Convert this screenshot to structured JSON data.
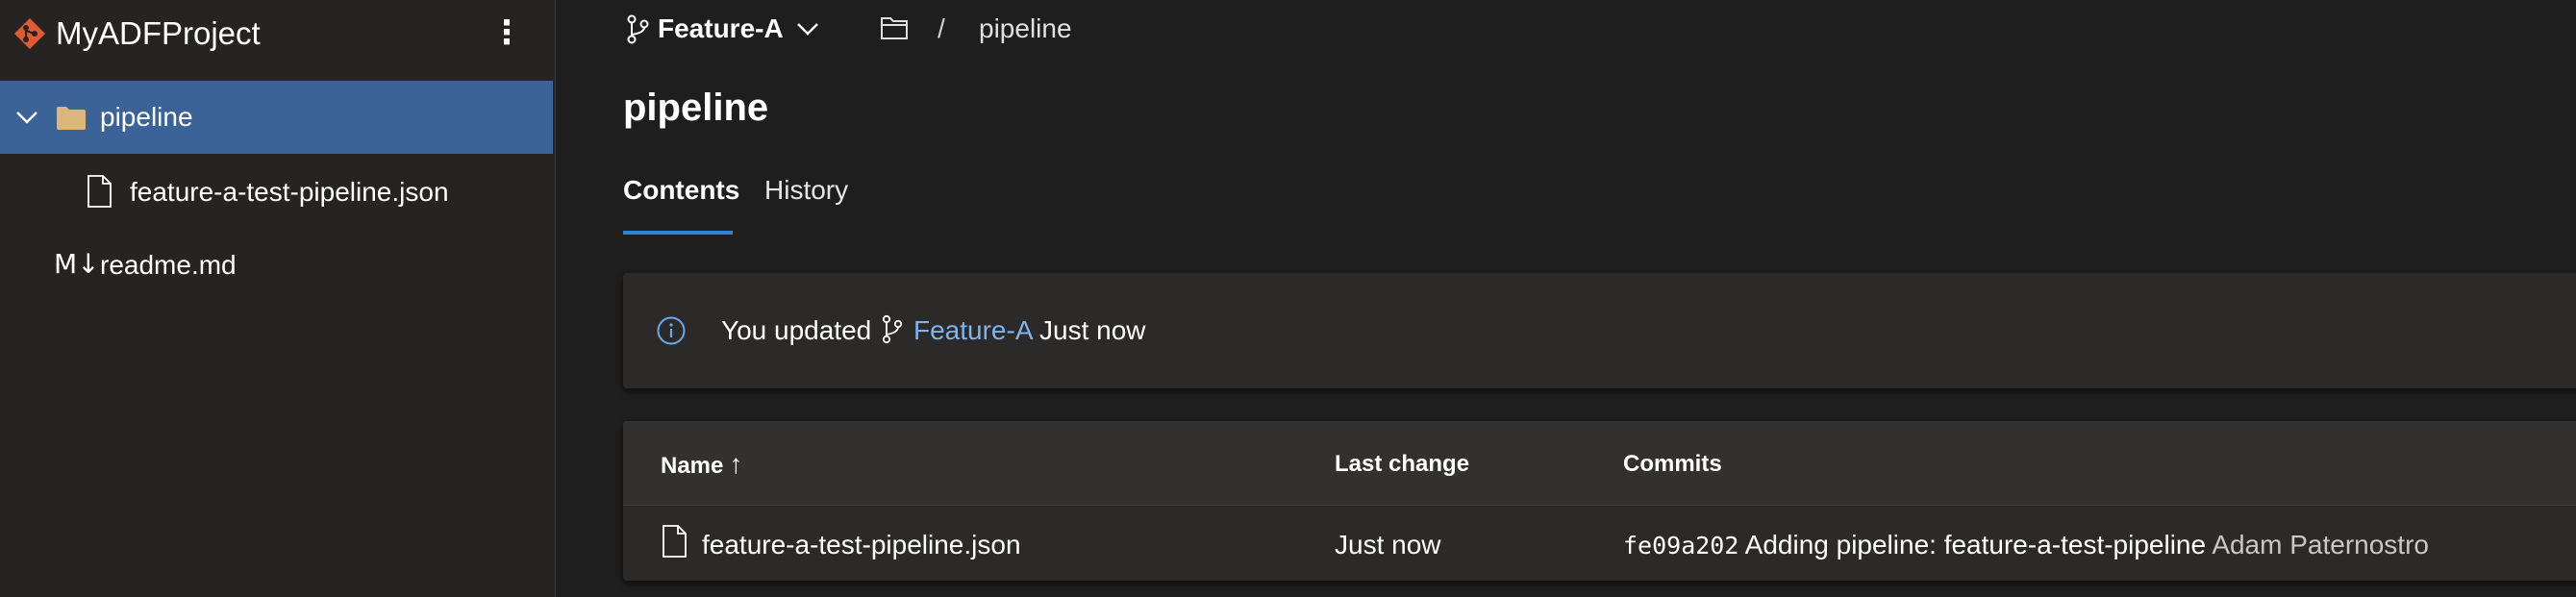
{
  "sidebar": {
    "repo_name": "MyADFProject",
    "menu_icon": "more-vertical-icon",
    "items": [
      {
        "label": "pipeline",
        "icon": "folder-icon",
        "expanded": true,
        "selected": true
      },
      {
        "label": "feature-a-test-pipeline.json",
        "icon": "file-icon"
      },
      {
        "label": "readme.md",
        "icon": "markdown-icon",
        "icon_text": "M↓"
      }
    ]
  },
  "header": {
    "branch": "Feature-A",
    "breadcrumb_sep": "/",
    "breadcrumb_current": "pipeline"
  },
  "page": {
    "title": "pipeline",
    "tabs": [
      {
        "label": "Contents",
        "active": true
      },
      {
        "label": "History",
        "active": false
      }
    ]
  },
  "banner": {
    "prefix": "You updated",
    "branch": "Feature-A",
    "suffix": "Just now"
  },
  "table": {
    "columns": [
      "Name",
      "Last change",
      "Commits"
    ],
    "sort_arrow": "↑",
    "rows": [
      {
        "name": "feature-a-test-pipeline.json",
        "last_change": "Just now",
        "commit_hash": "fe09a202",
        "commit_message": "Adding pipeline: feature-a-test-pipeline",
        "author": "Adam Paternostro"
      }
    ]
  },
  "colors": {
    "background": "#1e1e1e",
    "sidebar": "#252423",
    "selected": "#3c6397",
    "accent": "#2a86d9",
    "link": "#7fb3ea",
    "folder": "#dcb67a",
    "repo_icon": "#e05a32"
  }
}
